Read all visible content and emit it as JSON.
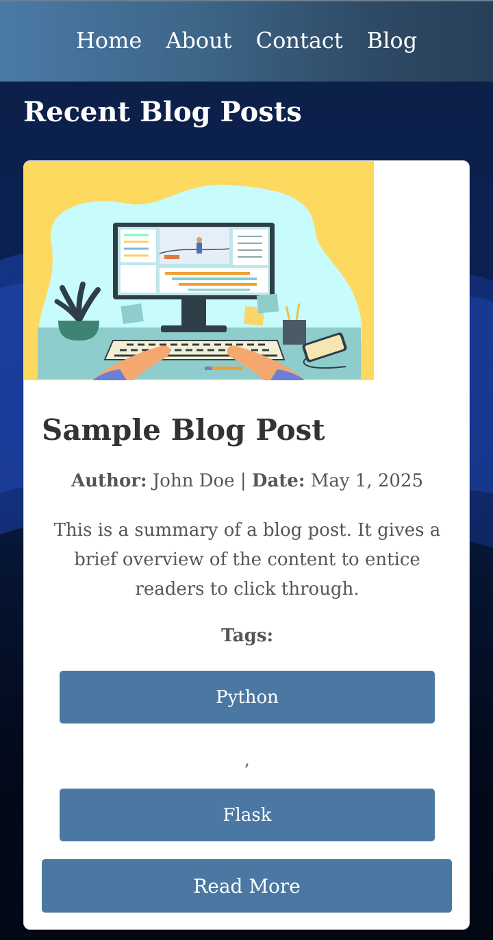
{
  "nav": {
    "items": [
      {
        "label": "Home"
      },
      {
        "label": "About"
      },
      {
        "label": "Contact"
      },
      {
        "label": "Blog"
      }
    ]
  },
  "page": {
    "title": "Recent Blog Posts"
  },
  "post": {
    "title": "Sample Blog Post",
    "author_label": "Author:",
    "author": "John Doe",
    "separator": "|",
    "date_label": "Date:",
    "date": "May 1, 2025",
    "summary": "This is a summary of a blog post. It gives a brief overview of the content to entice readers to click through.",
    "tags_label": "Tags:",
    "tags": [
      {
        "label": "Python"
      },
      {
        "label": "Flask"
      }
    ],
    "tag_separator": ",",
    "read_more_label": "Read More",
    "thumbnail_icon": "computer-desk-illustration"
  },
  "colors": {
    "nav_start": "#4a7aa6",
    "nav_end": "#27405a",
    "button": "#4a78a3",
    "thumb_bg": "#fdd960"
  }
}
